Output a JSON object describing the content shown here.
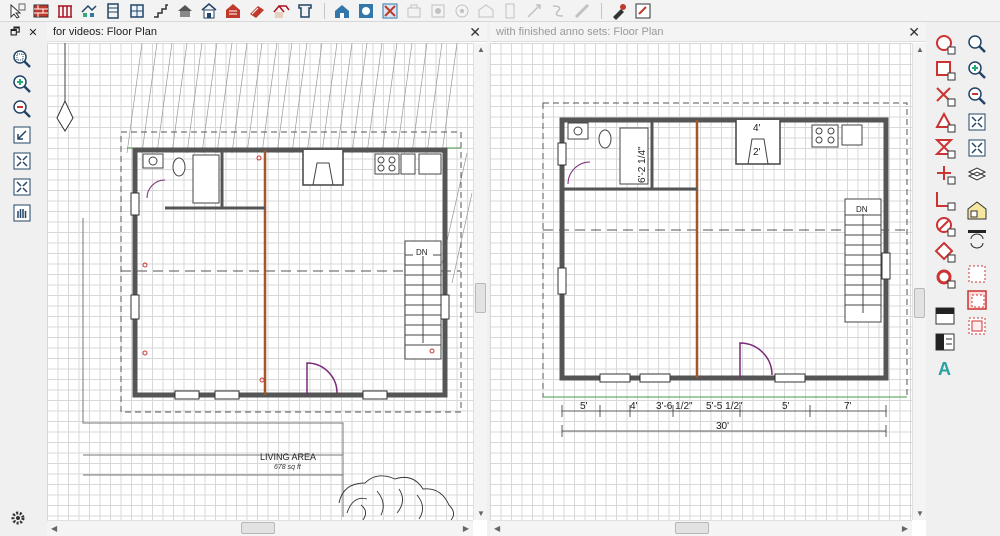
{
  "left_panel": {
    "title": "for videos: Floor Plan",
    "room_label": "LIVING AREA",
    "room_area": "678 sq ft",
    "stair_label": "DN"
  },
  "right_panel": {
    "title": "with finished anno sets: Floor Plan",
    "stair_label": "DN",
    "dims": {
      "d1": "5'",
      "d2": "4'",
      "d3": "3'-6 1/2\"",
      "d4": "5'-5 1/2\"",
      "d5": "5'",
      "d6": "7'",
      "total": "30'",
      "bath_wall": "6'-2 1/4\"",
      "chimney_w": "4'",
      "chimney_d": "2'"
    }
  },
  "icons": {
    "top_toolbar": [
      "select-objects",
      "wall-tool",
      "railing-tool",
      "cabinet-tool",
      "door-tool",
      "window-tool",
      "stairs-tool",
      "roof-tool",
      "build-house",
      "fireplace-tool",
      "framing-tool",
      "deck-tool",
      "terrain-tool",
      "camera-view",
      "plan-view",
      "delete-view",
      "text-tool",
      "dimension-tool",
      "elevation-tool",
      "render-tool",
      "cad-tool",
      "edit-tool",
      "paint-tool",
      "material-tool"
    ],
    "left_tools": [
      "zoom-icon",
      "zoom-in-icon",
      "zoom-out-icon",
      "undo-zoom-icon",
      "fill-window-icon",
      "fill-window-all-icon",
      "pan-icon"
    ],
    "right_tools": [
      "circle-tool",
      "rectangle-tool",
      "x-tool",
      "triangle-tool",
      "hourglass-tool",
      "plus-tool",
      "corner-tool",
      "circle-slash-tool",
      "diamond-tool",
      "circle-tool-2",
      "zoom-icon",
      "zoom-in-icon",
      "zoom-out-icon",
      "fill-window-icon",
      "fill-window-all-icon",
      "layers-icon",
      "layer-house-icon",
      "swap-icon",
      "select-tool",
      "select-tool-2",
      "select-tool-3",
      "plan-toggle-icon",
      "dimension-toggle-icon",
      "text-style-icon"
    ]
  }
}
